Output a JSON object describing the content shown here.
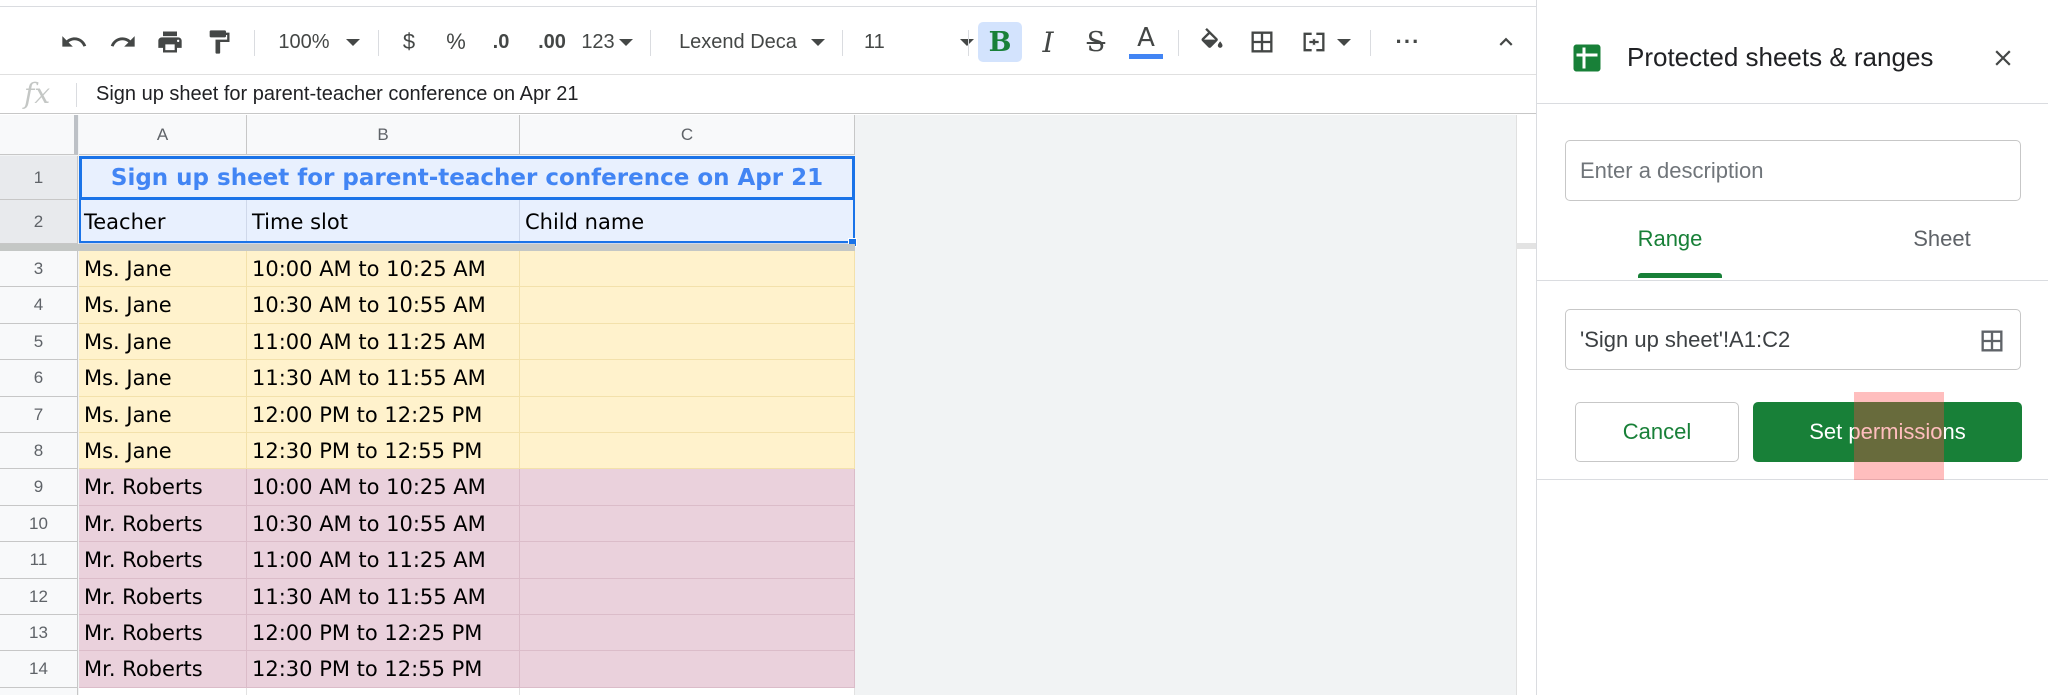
{
  "toolbar": {
    "zoom": "100%",
    "currency": "$",
    "percent": "%",
    "decrease_decimal": ".0",
    "increase_decimal": ".00",
    "number_format": "123",
    "font": "Lexend Deca",
    "font_size": "11",
    "bold": "B",
    "italic": "I",
    "strikethrough": "S",
    "text_color": "A",
    "more": "···"
  },
  "formula_bar": {
    "fx": "fx",
    "value": "Sign up sheet for parent-teacher conference on Apr 21"
  },
  "columns": [
    "A",
    "B",
    "C"
  ],
  "sheet": {
    "title": "Sign up sheet for parent-teacher conference on Apr 21",
    "headers": [
      "Teacher",
      "Time slot",
      "Child name"
    ],
    "rows": [
      {
        "num": "3",
        "teacher": "Ms. Jane",
        "slot": "10:00 AM to 10:25 AM",
        "child": ""
      },
      {
        "num": "4",
        "teacher": "Ms. Jane",
        "slot": "10:30 AM to 10:55 AM",
        "child": ""
      },
      {
        "num": "5",
        "teacher": "Ms. Jane",
        "slot": "11:00 AM to 11:25 AM",
        "child": ""
      },
      {
        "num": "6",
        "teacher": "Ms. Jane",
        "slot": "11:30 AM to 11:55 AM",
        "child": ""
      },
      {
        "num": "7",
        "teacher": "Ms. Jane",
        "slot": "12:00 PM to 12:25 PM",
        "child": ""
      },
      {
        "num": "8",
        "teacher": "Ms. Jane",
        "slot": "12:30 PM to 12:55 PM",
        "child": ""
      },
      {
        "num": "9",
        "teacher": "Mr. Roberts",
        "slot": "10:00 AM to 10:25 AM",
        "child": ""
      },
      {
        "num": "10",
        "teacher": "Mr. Roberts",
        "slot": "10:30 AM to 10:55 AM",
        "child": ""
      },
      {
        "num": "11",
        "teacher": "Mr. Roberts",
        "slot": "11:00 AM to 11:25 AM",
        "child": ""
      },
      {
        "num": "12",
        "teacher": "Mr. Roberts",
        "slot": "11:30 AM to 11:55 AM",
        "child": ""
      },
      {
        "num": "13",
        "teacher": "Mr. Roberts",
        "slot": "12:00 PM to 12:25 PM",
        "child": ""
      },
      {
        "num": "14",
        "teacher": "Mr. Roberts",
        "slot": "12:30 PM to 12:55 PM",
        "child": ""
      }
    ],
    "row_labels": [
      "1",
      "2"
    ]
  },
  "panel": {
    "title": "Protected sheets & ranges",
    "description_placeholder": "Enter a description",
    "tab_range": "Range",
    "tab_sheet": "Sheet",
    "range_value": "'Sign up sheet'!A1:C2",
    "cancel_label": "Cancel",
    "set_permissions_label": "Set permissions"
  },
  "colors": {
    "accent_green": "#188038",
    "selection_blue": "#1a73e8",
    "row_yellow": "#fff2cc",
    "row_pink": "#ead1dc",
    "header_blue": "#e8f0fe"
  }
}
